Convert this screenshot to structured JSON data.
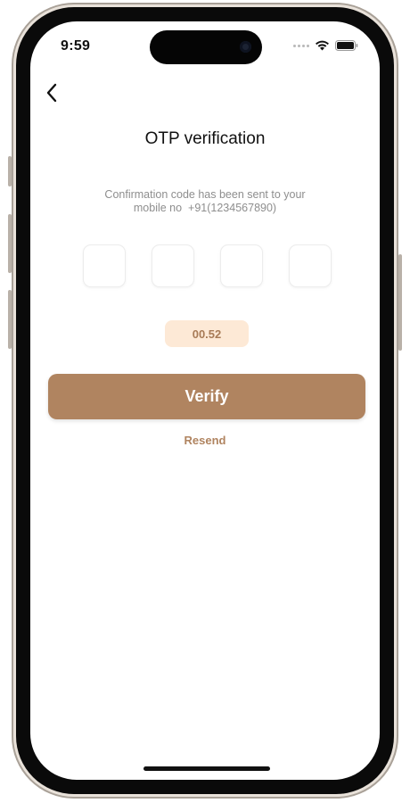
{
  "status_bar": {
    "time": "9:59",
    "icons": [
      "signal-dots-icon",
      "wifi-icon",
      "battery-icon"
    ]
  },
  "header": {
    "back_icon": "chevron-left-icon",
    "title": "OTP verification"
  },
  "message": {
    "line1": "Confirmation code has been sent to your",
    "line2": "mobile no  +91(1234567890)"
  },
  "otp": {
    "digits": [
      "",
      "",
      "",
      ""
    ]
  },
  "timer": {
    "value": "00.52"
  },
  "actions": {
    "verify_label": "Verify",
    "resend_label": "Resend"
  },
  "colors": {
    "accent": "#b08460",
    "timer_bg": "#fde9d6",
    "timer_text": "#a87b57",
    "subtitle_text": "#8e8e8e"
  }
}
